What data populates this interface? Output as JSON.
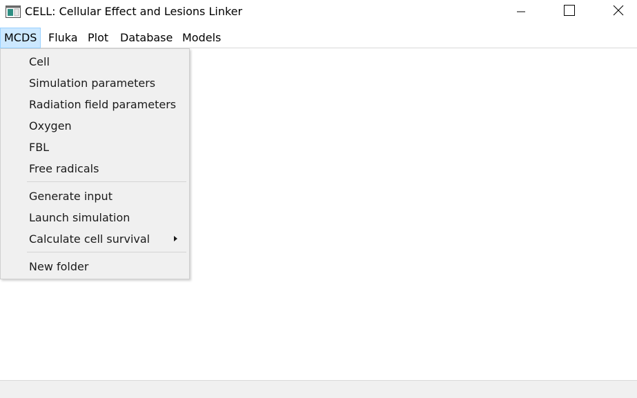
{
  "window": {
    "title": "CELL: Cellular Effect and Lesions Linker",
    "icons": {
      "app": "app-window-icon",
      "minimize": "minimize-icon",
      "maximize": "maximize-icon",
      "close": "close-icon"
    }
  },
  "menubar": {
    "items": [
      {
        "label": "MCDS",
        "active": true
      },
      {
        "label": "Fluka"
      },
      {
        "label": "Plot"
      },
      {
        "label": "Database"
      },
      {
        "label": "Models"
      }
    ]
  },
  "mcds_menu": {
    "items": [
      "Cell",
      "Simulation parameters",
      "Radiation field parameters",
      "Oxygen",
      "FBL",
      "Free radicals",
      "Generate input",
      "Launch simulation",
      "Calculate cell survival",
      "New folder"
    ],
    "submenu_icon": "chevron-right-icon"
  },
  "colors": {
    "menu_highlight": "#cce8ff",
    "menu_highlight_border": "#99d1ff",
    "dropdown_bg": "#f0f0f0"
  }
}
